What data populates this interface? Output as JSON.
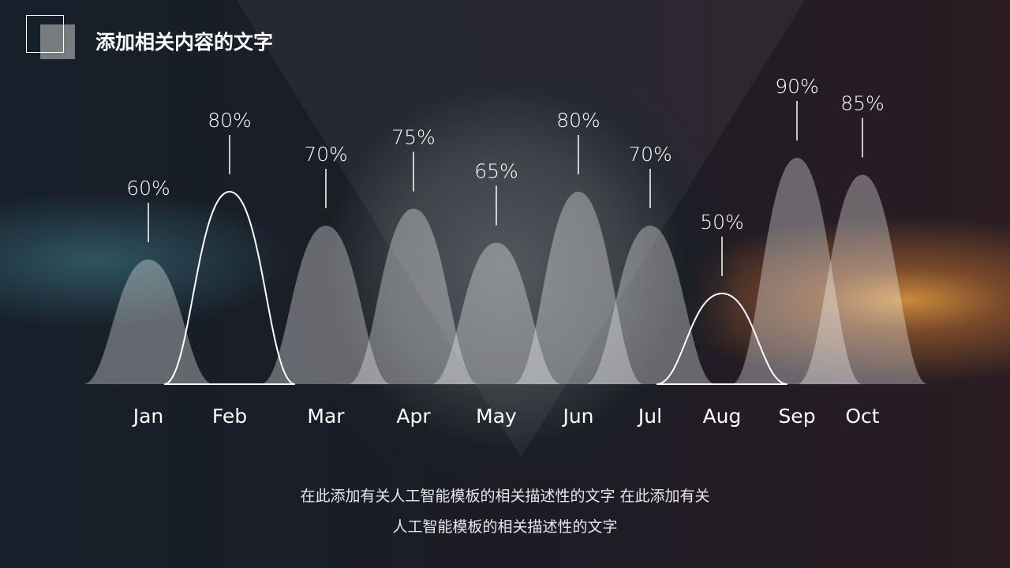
{
  "header": {
    "title": "添加相关内容的文字"
  },
  "description": {
    "line1": "在此添加有关人工智能模板的相关描述性的文字 在此添加有关",
    "line2": "人工智能模板的相关描述性的文字"
  },
  "chart_data": {
    "type": "area",
    "categories": [
      "Jan",
      "Feb",
      "Mar",
      "Apr",
      "May",
      "Jun",
      "Jul",
      "Aug",
      "Sep",
      "Oct"
    ],
    "values": [
      60,
      80,
      70,
      75,
      65,
      80,
      70,
      50,
      90,
      85
    ],
    "labels": [
      "60%",
      "80%",
      "70%",
      "75%",
      "65%",
      "80%",
      "70%",
      "50%",
      "90%",
      "85%"
    ],
    "highlighted": [
      "Feb",
      "Aug"
    ],
    "colors": {
      "fill": "#ffffff",
      "outline": "#ffffff"
    }
  }
}
